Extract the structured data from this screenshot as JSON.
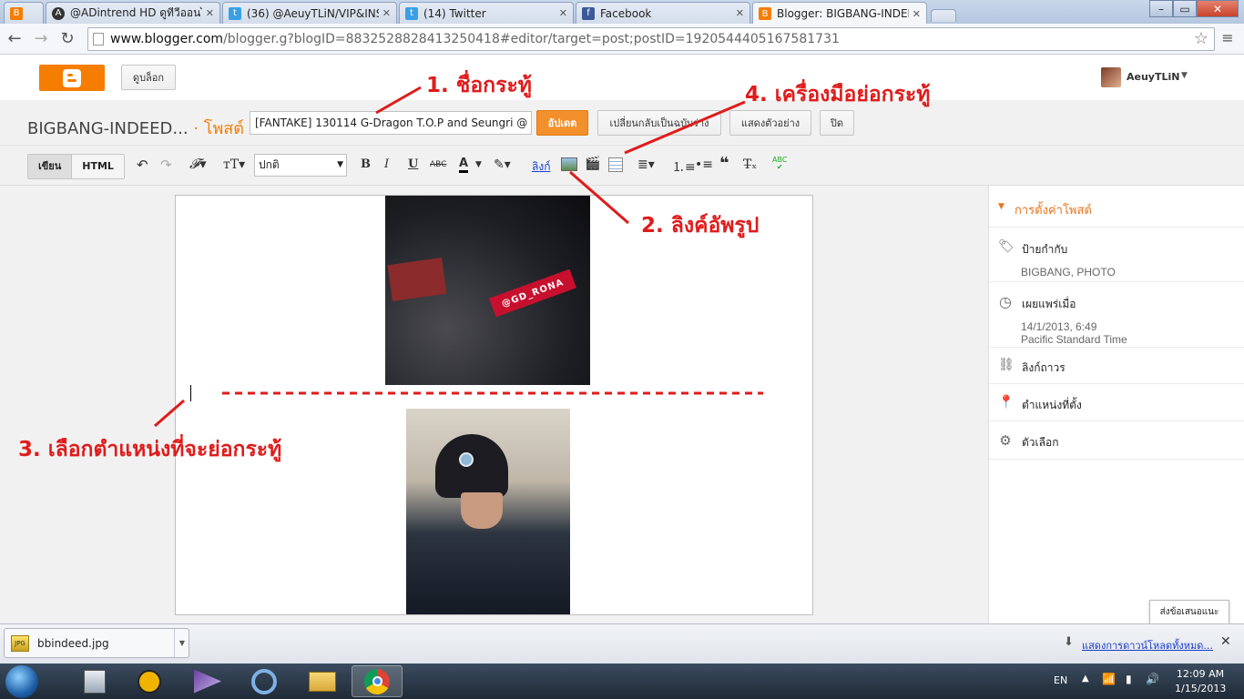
{
  "browser": {
    "tabs": [
      {
        "title": "@ADintrend HD ดูทีวีออนไล"
      },
      {
        "title": "(36) @AeuyTLiN/VIP&INS"
      },
      {
        "title": "(14) Twitter"
      },
      {
        "title": "Facebook"
      },
      {
        "title": "Blogger: BIGBANG-INDEE"
      }
    ],
    "url_host": "www.blogger.com",
    "url_path": "/blogger.g?blogID=8832528828413250418#editor/target=post;postID=1920544405167581731"
  },
  "header": {
    "view_blog_label": "ดูบล็อก",
    "username": "AeuyTLiN"
  },
  "post_bar": {
    "blog_title": "BIGBANG-INDEED...",
    "section": "· โพสต์",
    "post_title": "[FANTAKE] 130114 G-Dragon T.O.P and Seungri @",
    "update_label": "อัปเดต",
    "revert_label": "เปลี่ยนกลับเป็นฉบับร่าง",
    "preview_label": "แสดงตัวอย่าง",
    "close_label": "ปิด"
  },
  "toolbar": {
    "compose_label": "เขียน",
    "html_label": "HTML",
    "font_default": "ปกติ",
    "link_label": "ลิงก์"
  },
  "editor": {
    "watermark": "@GD_RONA"
  },
  "sidebar": {
    "title": "การตั้งค่าโพสต์",
    "labels_title": "ป้ายกำกับ",
    "labels_value": "BIGBANG, PHOTO",
    "published_title": "เผยแพร่เมื่อ",
    "published_date": "14/1/2013, 6:49",
    "published_tz": "Pacific Standard Time",
    "permalink_title": "ลิงก์ถาวร",
    "location_title": "ตำแหน่งที่ตั้ง",
    "options_title": "ตัวเลือก"
  },
  "feedback_label": "ส่งข้อเสนอแนะ",
  "download_bar": {
    "file_name": "bbindeed.jpg",
    "show_all": "แสดงการดาวน์โหลดทั้งหมด..."
  },
  "taskbar": {
    "lang": "EN",
    "time": "12:09 AM",
    "date": "1/15/2013"
  },
  "annotations": {
    "a1": "1. ชื่อกระทู้",
    "a2": "2. ลิงค์อัพรูป",
    "a3": "3. เลือกตำแหน่งที่จะย่อกระทู้",
    "a4": "4. เครื่องมือย่อกระทู้"
  },
  "colors": {
    "blogger_orange": "#f57d00",
    "annotation_red": "#e01b1b"
  }
}
